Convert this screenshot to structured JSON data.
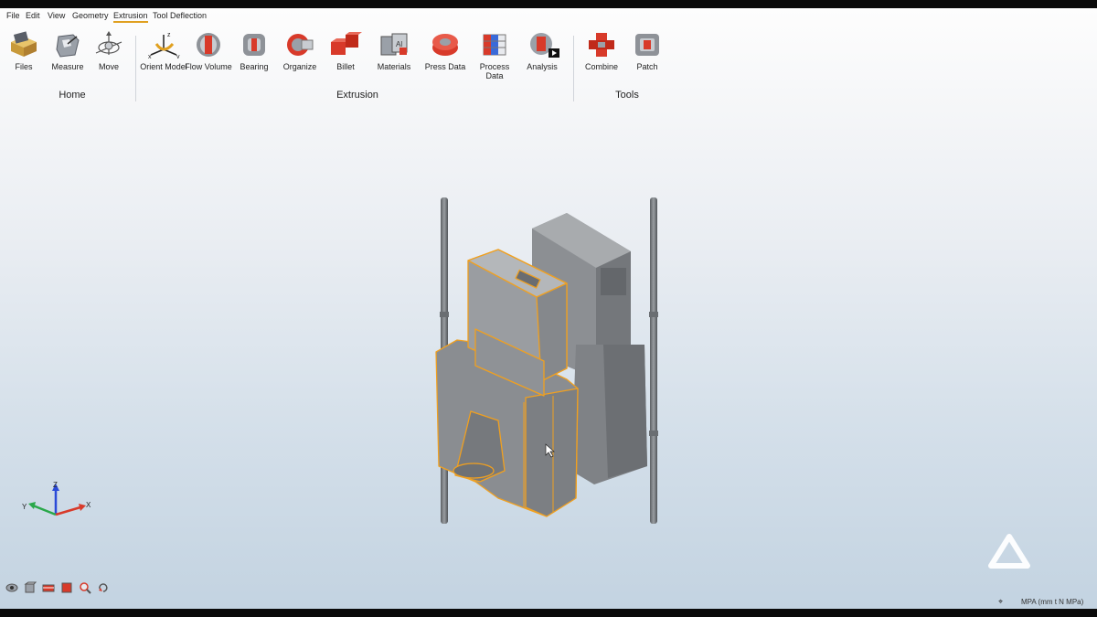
{
  "menu": [
    "File",
    "Edit",
    "View",
    "Geometry",
    "Extrusion",
    "Tool Deflection"
  ],
  "menu_active": "Extrusion",
  "ribbon": {
    "home": {
      "label": "Home",
      "buttons": [
        "Files",
        "Measure",
        "Move"
      ]
    },
    "extrusion": {
      "label": "Extrusion",
      "buttons": [
        "Orient Model",
        "Flow Volume",
        "Bearing",
        "Organize",
        "Billet",
        "Materials",
        "Press Data",
        "Process Data",
        "Analysis"
      ]
    },
    "tools": {
      "label": "Tools",
      "buttons": [
        "Combine",
        "Patch"
      ]
    }
  },
  "axes": {
    "z": "Z",
    "y": "Y",
    "x": "X"
  },
  "status": {
    "units": "MPA (mm t N MPa)"
  },
  "colors": {
    "accent": "#e8a020",
    "icon_red": "#d83a2a",
    "model_gray": "#8a8c8f",
    "selection_edge": "#f0a020"
  },
  "icons": [
    "files-icon",
    "measure-icon",
    "move-icon",
    "orient-model-icon",
    "flow-volume-icon",
    "bearing-icon",
    "organize-icon",
    "billet-icon",
    "materials-icon",
    "press-data-icon",
    "process-data-icon",
    "analysis-icon",
    "combine-icon",
    "patch-icon"
  ]
}
